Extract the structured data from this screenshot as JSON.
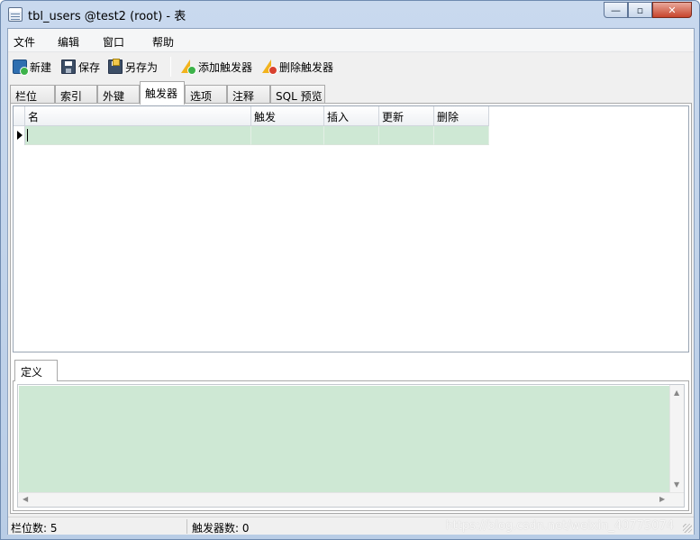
{
  "window": {
    "title": "tbl_users @test2 (root) - 表",
    "minimize_glyph": "—",
    "maximize_glyph": "▫",
    "close_glyph": "✕"
  },
  "menu": [
    "文件",
    "编辑",
    "窗口",
    "帮助"
  ],
  "toolbar": {
    "new": "新建",
    "save": "保存",
    "save_as": "另存为",
    "add_trigger": "添加触发器",
    "delete_trigger": "删除触发器"
  },
  "tabs": [
    "栏位",
    "索引",
    "外键",
    "触发器",
    "选项",
    "注释",
    "SQL 预览"
  ],
  "active_tab": "触发器",
  "grid": {
    "columns": [
      "名",
      "触发",
      "插入",
      "更新",
      "删除"
    ],
    "rows": [
      [
        "",
        "",
        "",
        "",
        ""
      ]
    ]
  },
  "definition": {
    "tab_label": "定义",
    "text": ""
  },
  "status": {
    "fields": "栏位数: 5",
    "triggers": "触发器数: 0"
  },
  "watermark": "https://blog.csdn.net/weixin_40775074",
  "icons": {
    "new": "new-table-icon",
    "save": "save-icon",
    "save_as": "save-as-icon",
    "add_trigger": "add-trigger-icon",
    "delete_trigger": "delete-trigger-icon"
  },
  "colors": {
    "selected_row": "#cee8d4",
    "titlebar": "#c9d9ee",
    "close_button": "#c7442c"
  }
}
